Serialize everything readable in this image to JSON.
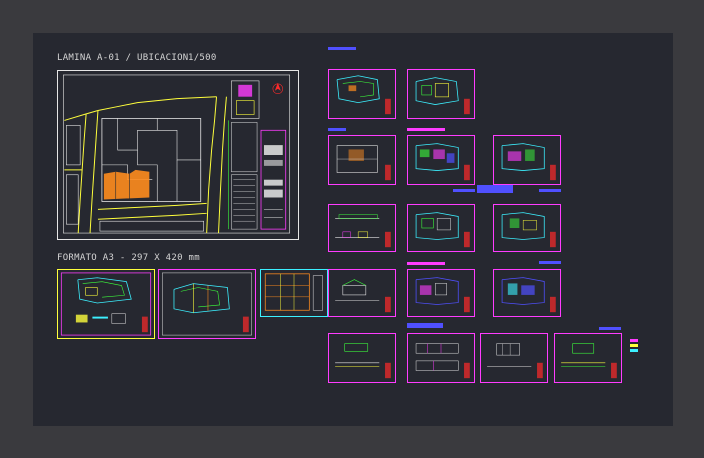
{
  "drawing": {
    "main_title": "LAMINA A-01 / UBICACION",
    "scale": "1/500",
    "format_title": "FORMATO A3 - 297 X 420 mm"
  },
  "colors": {
    "background": "#262830",
    "outer_border": "#3a3a3e",
    "white_line": "#e6e6e6",
    "magenta": "#ff3cff",
    "yellow": "#ffff3c",
    "orange": "#ff8c1e",
    "cyan": "#3cf0ff",
    "blue": "#5050ff",
    "green": "#3cff3c",
    "red": "#ff2a2a"
  },
  "icons": {
    "north_arrow": "north-arrow-icon",
    "title_block": "title-block-icon"
  }
}
